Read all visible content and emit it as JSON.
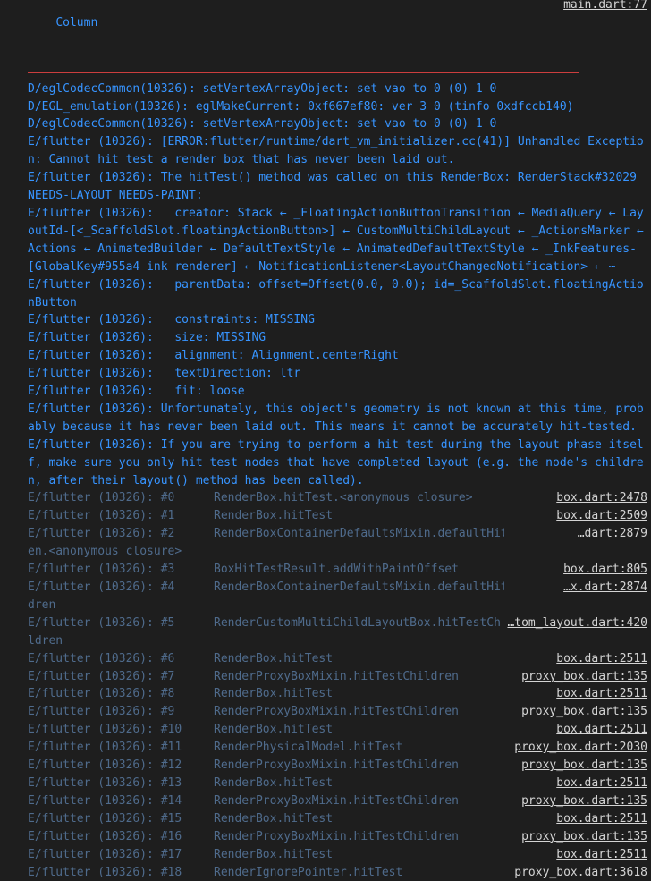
{
  "header": {
    "widget": "Column",
    "file_link": "main.dart:77"
  },
  "log_lines": [
    "D/eglCodecCommon(10326): setVertexArrayObject: set vao to 0 (0) 1 0",
    "D/EGL_emulation(10326): eglMakeCurrent: 0xf667ef80: ver 3 0 (tinfo 0xdfccb140)",
    "D/eglCodecCommon(10326): setVertexArrayObject: set vao to 0 (0) 1 0",
    "E/flutter (10326): [ERROR:flutter/runtime/dart_vm_initializer.cc(41)] Unhandled Exception: Cannot hit test a render box that has never been laid out.",
    "E/flutter (10326): The hitTest() method was called on this RenderBox: RenderStack#32029 NEEDS-LAYOUT NEEDS-PAINT:",
    "E/flutter (10326):   creator: Stack ← _FloatingActionButtonTransition ← MediaQuery ← LayoutId-[<_ScaffoldSlot.floatingActionButton>] ← CustomMultiChildLayout ← _ActionsMarker ← Actions ← AnimatedBuilder ← DefaultTextStyle ← AnimatedDefaultTextStyle ← _InkFeatures-[GlobalKey#955a4 ink renderer] ← NotificationListener<LayoutChangedNotification> ← ⋯",
    "E/flutter (10326):   parentData: offset=Offset(0.0, 0.0); id=_ScaffoldSlot.floatingActionButton",
    "E/flutter (10326):   constraints: MISSING",
    "E/flutter (10326):   size: MISSING",
    "E/flutter (10326):   alignment: Alignment.centerRight",
    "E/flutter (10326):   textDirection: ltr",
    "E/flutter (10326):   fit: loose",
    "E/flutter (10326): Unfortunately, this object's geometry is not known at this time, probably because it has never been laid out. This means it cannot be accurately hit-tested.",
    "E/flutter (10326): If you are trying to perform a hit test during the layout phase itself, make sure you only hit test nodes that have completed layout (e.g. the node's children, after their layout() method has been called)."
  ],
  "frames": [
    {
      "prefix": "E/flutter (10326): #0",
      "fn": "RenderBox.hitTest.<anonymous closure>",
      "link": "box.dart:2478",
      "cont": ""
    },
    {
      "prefix": "E/flutter (10326): #1",
      "fn": "RenderBox.hitTest",
      "link": "box.dart:2509",
      "cont": ""
    },
    {
      "prefix": "E/flutter (10326): #2",
      "fn": "RenderBoxContainerDefaultsMixin.defaultHitTestChildr",
      "link": "…dart:2879",
      "cont": "en.<anonymous closure>"
    },
    {
      "prefix": "E/flutter (10326): #3",
      "fn": "BoxHitTestResult.addWithPaintOffset",
      "link": "box.dart:805",
      "cont": ""
    },
    {
      "prefix": "E/flutter (10326): #4",
      "fn": "RenderBoxContainerDefaultsMixin.defaultHitTestChil",
      "link": "…x.dart:2874",
      "cont": "dren"
    },
    {
      "prefix": "E/flutter (10326): #5",
      "fn": "RenderCustomMultiChildLayoutBox.hitTestChi",
      "link": "…tom_layout.dart:420",
      "cont": "ldren"
    },
    {
      "prefix": "E/flutter (10326): #6",
      "fn": "RenderBox.hitTest",
      "link": "box.dart:2511",
      "cont": ""
    },
    {
      "prefix": "E/flutter (10326): #7",
      "fn": "RenderProxyBoxMixin.hitTestChildren",
      "link": "proxy_box.dart:135",
      "cont": ""
    },
    {
      "prefix": "E/flutter (10326): #8",
      "fn": "RenderBox.hitTest",
      "link": "box.dart:2511",
      "cont": ""
    },
    {
      "prefix": "E/flutter (10326): #9",
      "fn": "RenderProxyBoxMixin.hitTestChildren",
      "link": "proxy_box.dart:135",
      "cont": ""
    },
    {
      "prefix": "E/flutter (10326): #10",
      "fn": "RenderBox.hitTest",
      "link": "box.dart:2511",
      "cont": ""
    },
    {
      "prefix": "E/flutter (10326): #11",
      "fn": "RenderPhysicalModel.hitTest",
      "link": "proxy_box.dart:2030",
      "cont": ""
    },
    {
      "prefix": "E/flutter (10326): #12",
      "fn": "RenderProxyBoxMixin.hitTestChildren",
      "link": "proxy_box.dart:135",
      "cont": ""
    },
    {
      "prefix": "E/flutter (10326): #13",
      "fn": "RenderBox.hitTest",
      "link": "box.dart:2511",
      "cont": ""
    },
    {
      "prefix": "E/flutter (10326): #14",
      "fn": "RenderProxyBoxMixin.hitTestChildren",
      "link": "proxy_box.dart:135",
      "cont": ""
    },
    {
      "prefix": "E/flutter (10326): #15",
      "fn": "RenderBox.hitTest",
      "link": "box.dart:2511",
      "cont": ""
    },
    {
      "prefix": "E/flutter (10326): #16",
      "fn": "RenderProxyBoxMixin.hitTestChildren",
      "link": "proxy_box.dart:135",
      "cont": ""
    },
    {
      "prefix": "E/flutter (10326): #17",
      "fn": "RenderBox.hitTest",
      "link": "box.dart:2511",
      "cont": ""
    },
    {
      "prefix": "E/flutter (10326): #18",
      "fn": "RenderIgnorePointer.hitTest",
      "link": "proxy_box.dart:3618",
      "cont": ""
    }
  ],
  "colors": {
    "background": "#1e1e1e",
    "log_text": "#3794ff",
    "frame_text": "#4f6b8c",
    "link_text": "#d4d4d4",
    "divider": "#cc3e3e"
  }
}
